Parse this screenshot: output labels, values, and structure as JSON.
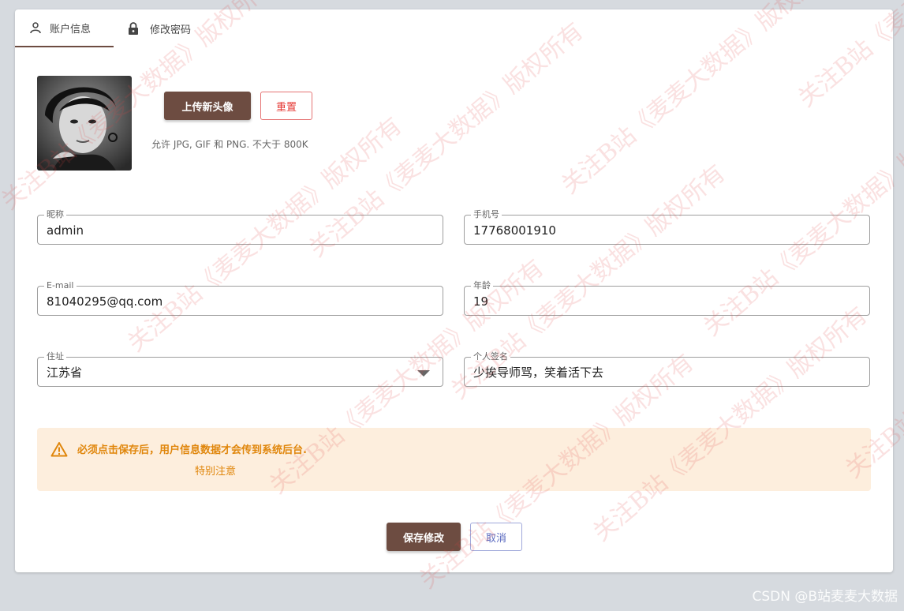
{
  "tabs": [
    {
      "label": "账户信息",
      "icon": "user-icon",
      "active": true
    },
    {
      "label": "修改密码",
      "icon": "lock-icon",
      "active": false
    }
  ],
  "avatar": {
    "upload_label": "上传新头像",
    "reset_label": "重置",
    "hint": "允许 JPG, GIF 和 PNG. 不大于 800K"
  },
  "form": {
    "nickname": {
      "label": "昵称",
      "value": "admin"
    },
    "phone": {
      "label": "手机号",
      "value": "17768001910"
    },
    "email": {
      "label": "E-mail",
      "value": "81040295@qq.com"
    },
    "age": {
      "label": "年龄",
      "value": "19"
    },
    "address": {
      "label": "住址",
      "value": "江苏省"
    },
    "signature": {
      "label": "个人签名",
      "value": "少挨导师骂，笑着活下去"
    }
  },
  "alert": {
    "message": "必须点击保存后，用户信息数据才会传到系统后台.",
    "sub": "特别注意",
    "color": "#e0860b"
  },
  "actions": {
    "save_label": "保存修改",
    "cancel_label": "取消"
  },
  "watermark": {
    "text": "关注B站《麦麦大数据》版权所有"
  },
  "credit": "CSDN @B站麦麦大数据",
  "colors": {
    "primary": "#6d4c41",
    "danger": "#e53935",
    "secondary": "#5c6bc0",
    "alert_bg": "#fdeedd"
  }
}
